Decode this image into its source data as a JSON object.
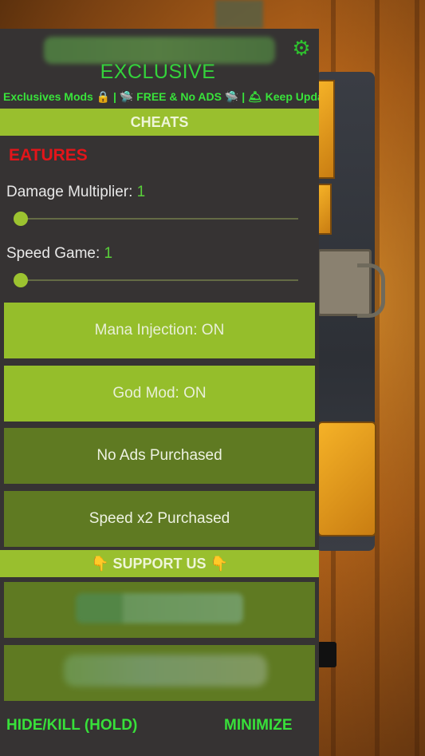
{
  "menu": {
    "title": "EXCLUSIVE",
    "marquee": "Exclusives Mods 🔒 | 🛸 FREE & No ADS 🛸 | 🛎 Keep Upda",
    "settings_icon": "gear-icon",
    "cheats_header": "CHEATS",
    "features_label": "EATURES",
    "sliders": [
      {
        "label": "Damage Multiplier: ",
        "value": "1"
      },
      {
        "label": "Speed Game: ",
        "value": "1"
      }
    ],
    "toggles": [
      {
        "label": "Mana Injection: ON",
        "state": "on"
      },
      {
        "label": "God Mod: ON",
        "state": "on"
      },
      {
        "label": "No Ads Purchased",
        "state": "off"
      },
      {
        "label": "Speed x2 Purchased",
        "state": "off"
      }
    ],
    "support_header": "👇 SUPPORT US 👇",
    "footer": {
      "hide_label": "HIDE/KILL (HOLD)",
      "minimize_label": "MINIMIZE"
    }
  },
  "colors": {
    "accent_green": "#99bf2e",
    "button_on": "#95be2b",
    "button_off": "#5f7a22",
    "title_green": "#34d23b",
    "features_red": "#e3151a",
    "panel_bg": "#363333"
  }
}
